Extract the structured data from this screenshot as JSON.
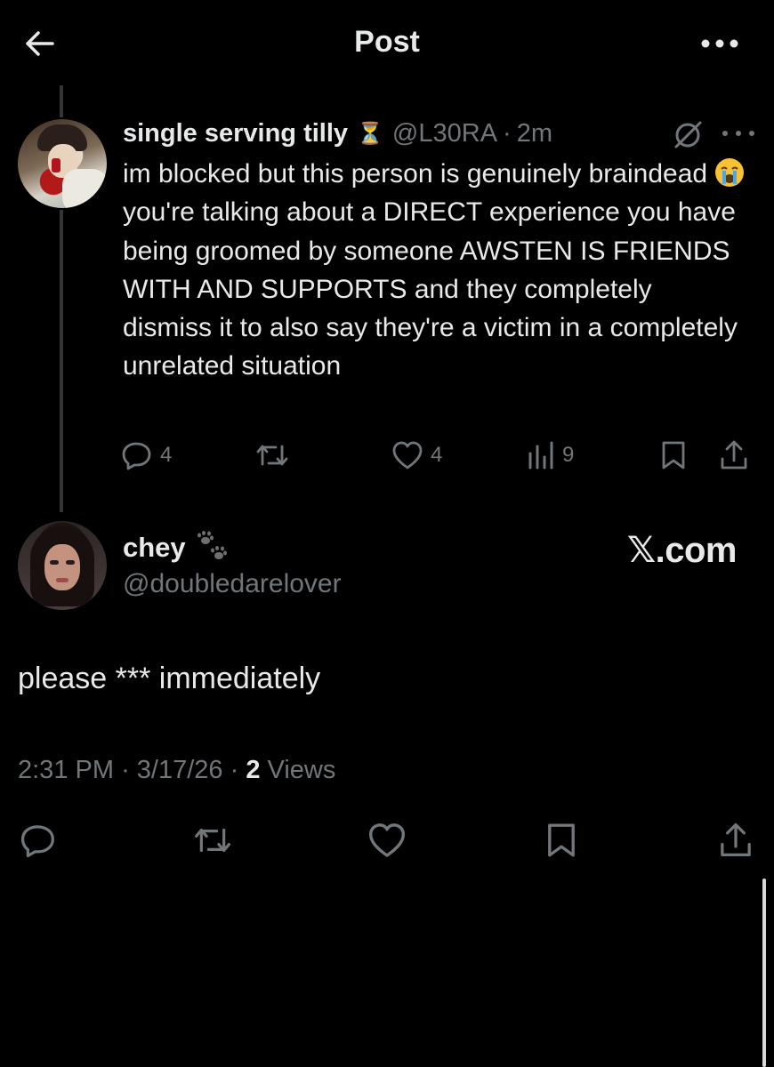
{
  "header": {
    "title": "Post"
  },
  "parent_post": {
    "author_name": "single serving tilly",
    "author_badge": "⏳",
    "handle": "@L30RA",
    "time": "2m",
    "body_before_emoji": "im blocked but this person is genuinely braindead ",
    "body_after_emoji": " you're talking about a DIRECT experience you have being groomed by someone AWSTEN IS FRIENDS WITH AND SUPPORTS and they completely dismiss it to also say they're a victim in a completely unrelated situation",
    "replies": "4",
    "likes": "4",
    "views": "9"
  },
  "main_post": {
    "author_name": "chey",
    "handle": "@doubledarelover",
    "source_label": "𝕏.com",
    "body": "please *** immediately",
    "time": "2:31 PM",
    "date": "3/17/26",
    "views_count": "2",
    "views_label": "Views"
  },
  "colors": {
    "background": "#000000",
    "text_primary": "#e7e9ea",
    "text_secondary": "#71767b",
    "thread_line": "#333639"
  }
}
